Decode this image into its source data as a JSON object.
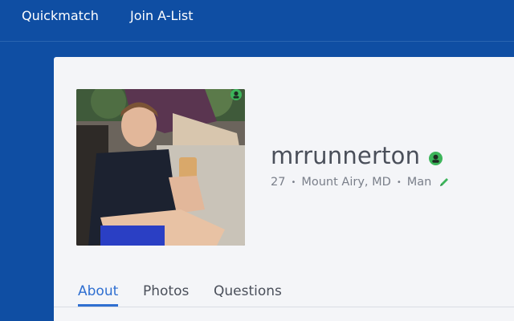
{
  "nav": {
    "items": [
      {
        "label": "Quickmatch"
      },
      {
        "label": "Join A-List"
      }
    ]
  },
  "profile": {
    "username": "mrrunnerton",
    "age": "27",
    "location": "Mount Airy, MD",
    "gender": "Man",
    "separator": "•",
    "online": true
  },
  "tabs": [
    {
      "label": "About",
      "active": true
    },
    {
      "label": "Photos",
      "active": false
    },
    {
      "label": "Questions",
      "active": false
    }
  ],
  "colors": {
    "brand_blue": "#0f4ea3",
    "accent_blue": "#2f6fd1",
    "online_green": "#3cb45a"
  }
}
